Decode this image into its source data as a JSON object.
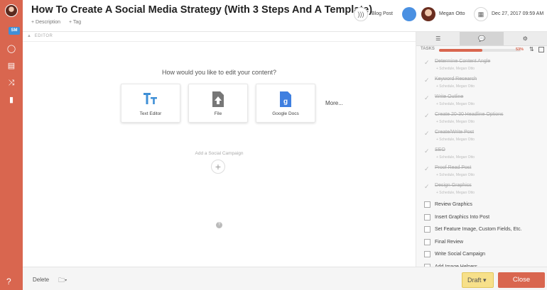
{
  "header": {
    "title": "How To Create A Social Media Strategy (With 3 Steps And A Template)",
    "description_link": "+ Description",
    "tag_link": "+ Tag",
    "type_label": "Blog Post",
    "owner": "Megan Otto",
    "date": "Dec 27, 2017 09:59 AM"
  },
  "editor": {
    "section_label": "EDITOR",
    "prompt": "How would you like to edit your content?",
    "options": [
      {
        "label": "Text Editor",
        "icon": "text-editor-icon"
      },
      {
        "label": "File",
        "icon": "file-upload-icon"
      },
      {
        "label": "Google Docs",
        "icon": "google-docs-icon"
      }
    ],
    "more": "More...",
    "social_campaign_label": "Add a Social Campaign"
  },
  "panel": {
    "tasks_label": "TASKS",
    "progress_pct_label": "53%",
    "progress_fraction": 0.53,
    "done_tasks": [
      {
        "name": "Determine Content Angle",
        "sub": "+ Schedule,   Megan Otto"
      },
      {
        "name": "Keyword Research",
        "sub": "+ Schedule,   Megan Otto"
      },
      {
        "name": "Write Outline",
        "sub": "+ Schedule,   Megan Otto"
      },
      {
        "name": "Create 20-30 Headline Options",
        "sub": "+ Schedule,   Megan Otto"
      },
      {
        "name": "Create/Write Post",
        "sub": "+ Schedule,   Megan Otto"
      },
      {
        "name": "SEO",
        "sub": "+ Schedule,   Megan Otto"
      },
      {
        "name": "Proof Read Post",
        "sub": "+ Schedule,   Megan Otto"
      },
      {
        "name": "Design Graphics",
        "sub": "+ Schedule,   Megan Otto"
      }
    ],
    "open_tasks": [
      "Review Graphics",
      "Insert Graphics Into Post",
      "Set Feature Image, Custom Fields, Etc.",
      "Final Review",
      "Write Social Campaign",
      "Add Image Helpers"
    ]
  },
  "footer": {
    "delete_label": "Delete",
    "draft_label": "Draft",
    "close_label": "Close"
  },
  "colors": {
    "accent": "#d9664f",
    "draft": "#f7e08a",
    "blue": "#4a90e2"
  }
}
